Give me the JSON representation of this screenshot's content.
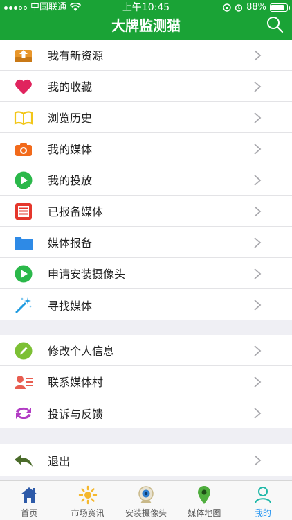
{
  "status_bar": {
    "carrier": "中国联通",
    "time": "上午10:45",
    "battery": "88%",
    "battery_level": 0.88
  },
  "nav": {
    "title": "大牌监测猫",
    "search_icon": "search-icon"
  },
  "menu_group_1": [
    {
      "label": "我有新资源",
      "icon": "inbox-upload-icon",
      "color": "#e8962a"
    },
    {
      "label": "我的收藏",
      "icon": "heart-icon",
      "color": "#e0245e"
    },
    {
      "label": "浏览历史",
      "icon": "open-book-icon",
      "color": "#f2c618"
    },
    {
      "label": "我的媒体",
      "icon": "camera-icon",
      "color": "#f26a1b"
    },
    {
      "label": "我的投放",
      "icon": "play-circle-icon",
      "color": "#2bb84a"
    },
    {
      "label": "已报备媒体",
      "icon": "list-document-icon",
      "color": "#e5372c"
    },
    {
      "label": "媒体报备",
      "icon": "folder-icon",
      "color": "#2e8ae6"
    },
    {
      "label": "申请安装摄像头",
      "icon": "play-circle-icon",
      "color": "#2bb84a"
    },
    {
      "label": "寻找媒体",
      "icon": "magic-wand-icon",
      "color": "#1f9be0"
    }
  ],
  "menu_group_2": [
    {
      "label": "修改个人信息",
      "icon": "pencil-circle-icon",
      "color": "#7cc034"
    },
    {
      "label": "联系媒体村",
      "icon": "contact-card-icon",
      "color": "#e85d50"
    },
    {
      "label": "投诉与反馈",
      "icon": "sync-arrows-icon",
      "color": "#b23cc4"
    }
  ],
  "menu_group_3": [
    {
      "label": "退出",
      "icon": "reply-arrow-icon",
      "color": "#4a6b2a"
    }
  ],
  "tab_bar": [
    {
      "label": "首页",
      "icon": "home-icon",
      "active": false
    },
    {
      "label": "市场资讯",
      "icon": "sun-icon",
      "active": false
    },
    {
      "label": "安装摄像头",
      "icon": "webcam-icon",
      "active": false
    },
    {
      "label": "媒体地图",
      "icon": "map-pin-icon",
      "active": false
    },
    {
      "label": "我的",
      "icon": "user-icon",
      "active": true
    }
  ],
  "colors": {
    "brand_green": "#1aa336",
    "active_tab": "#1a8ff0",
    "background": "#efeff4"
  }
}
